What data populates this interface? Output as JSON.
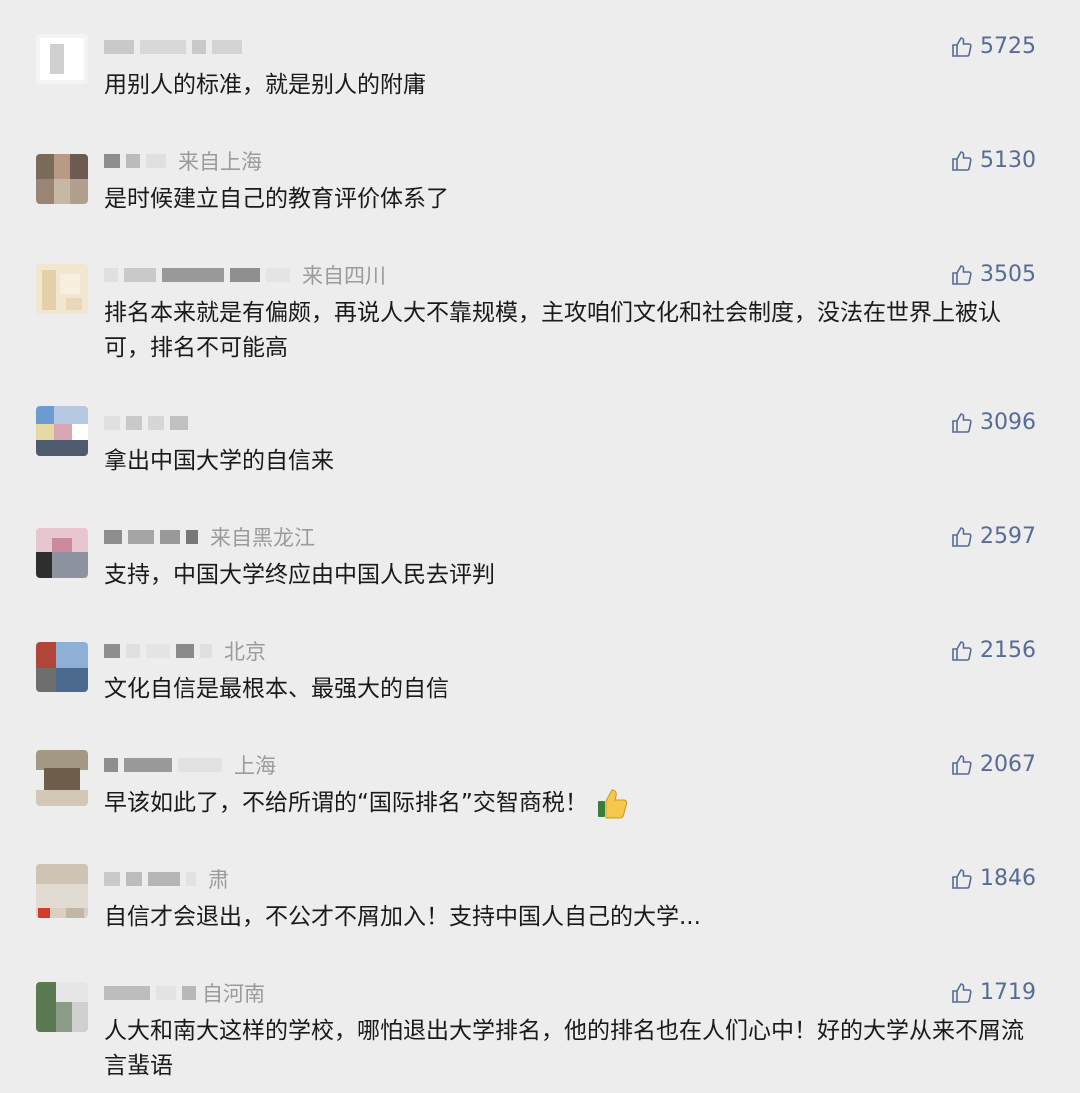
{
  "comments": [
    {
      "location": "",
      "likes": "5725",
      "text": "用别人的标准，就是别人的附庸"
    },
    {
      "location": "来自上海",
      "likes": "5130",
      "text": "是时候建立自己的教育评价体系了"
    },
    {
      "location": "来自四川",
      "likes": "3505",
      "text": "排名本来就是有偏颇，再说人大不靠规模，主攻咱们文化和社会制度，没法在世界上被认可，排名不可能高"
    },
    {
      "location": "",
      "likes": "3096",
      "text": "拿出中国大学的自信来"
    },
    {
      "location": "来自黑龙江",
      "likes": "2597",
      "text": "支持，中国大学终应由中国人民去评判"
    },
    {
      "location": "北京",
      "likes": "2156",
      "text": "文化自信是最根本、最强大的自信"
    },
    {
      "location": "上海",
      "likes": "2067",
      "text": "早该如此了，不给所谓的“国际排名”交智商税！"
    },
    {
      "location": "肃",
      "likes": "1846",
      "text": "自信才会退出，不公才不屑加入！支持中国人自己的大学..."
    },
    {
      "location": "自河南",
      "likes": "1719",
      "text": "人大和南大这样的学校，哪怕退出大学排名，他的排名也在人们心中！好的大学从来不屑流言蜚语"
    }
  ],
  "icons": {
    "like": "thumbs-up-icon",
    "emoji": "thumbs-up-emoji-icon"
  },
  "colors": {
    "background": "#ededed",
    "like": "#576b95",
    "location": "#9b9b9b",
    "text": "#1a1a1a"
  }
}
